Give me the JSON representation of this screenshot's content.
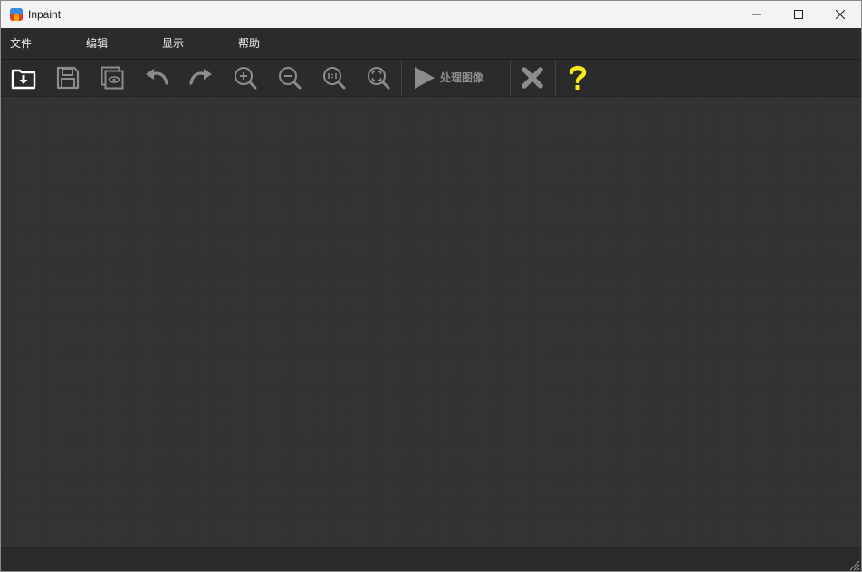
{
  "window": {
    "title": "Inpaint"
  },
  "menu": {
    "file": "文件",
    "edit": "编辑",
    "view": "显示",
    "help": "帮助"
  },
  "toolbar": {
    "process_label": "处理图像",
    "icons": [
      "open-icon",
      "save-icon",
      "preview-icon",
      "undo-icon",
      "redo-icon",
      "zoom-in-icon",
      "zoom-out-icon",
      "actual-size-icon",
      "fit-screen-icon",
      "play-icon",
      "clear-icon",
      "help-icon"
    ]
  },
  "colors": {
    "accent_help": "#f6e81a",
    "disabled_icon": "#8c8c8c",
    "background": "#333333"
  }
}
